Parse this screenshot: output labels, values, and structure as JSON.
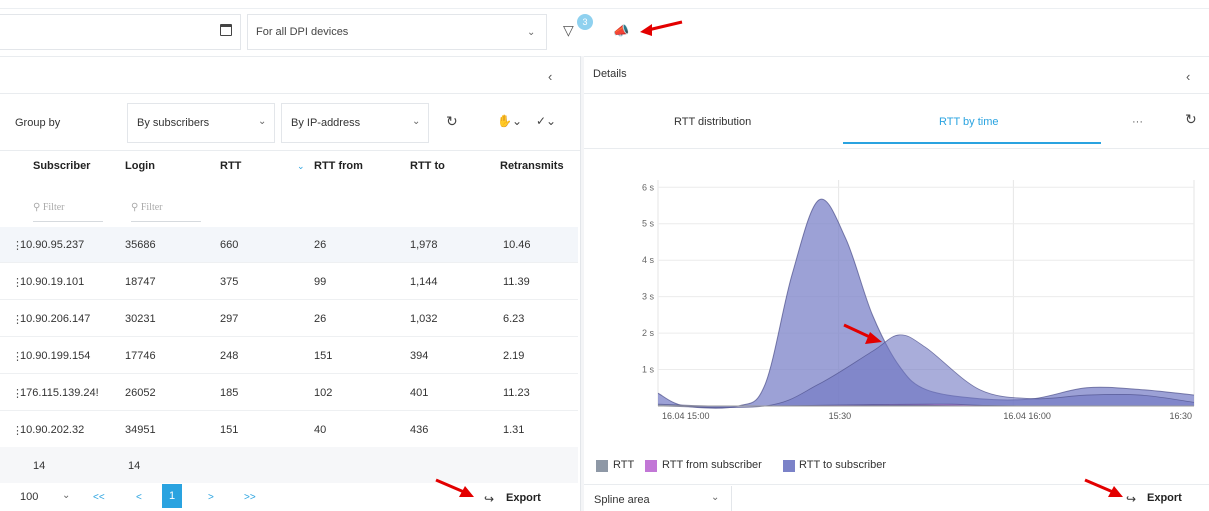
{
  "toolbar": {
    "dpi_select": "For all DPI devices",
    "filter_badge": "3"
  },
  "left": {
    "group_by_label": "Group by",
    "group_select_1": "By subscribers",
    "group_select_2": "By IP-address",
    "columns": [
      "Subscriber",
      "Login",
      "RTT",
      "RTT from",
      "RTT to",
      "Retransmits"
    ],
    "filter_placeholder": "Filter",
    "rows": [
      [
        "10.90.95.237",
        "35686",
        "660",
        "26",
        "1,978",
        "10.46"
      ],
      [
        "10.90.19.101",
        "18747",
        "375",
        "99",
        "1,144",
        "11.39"
      ],
      [
        "10.90.206.147",
        "30231",
        "297",
        "26",
        "1,032",
        "6.23"
      ],
      [
        "10.90.199.154",
        "17746",
        "248",
        "151",
        "394",
        "2.19"
      ],
      [
        "176.115.139.24!",
        "26052",
        "185",
        "102",
        "401",
        "11.23"
      ],
      [
        "10.90.202.32",
        "34951",
        "151",
        "40",
        "436",
        "1.31"
      ]
    ],
    "footer": [
      "14",
      "14"
    ],
    "page_size": "100",
    "pager": {
      "first": "<<",
      "prev": "<",
      "current": "1",
      "next": ">",
      "last": ">>"
    },
    "export": "Export"
  },
  "right": {
    "title": "Details",
    "tabs": [
      "RTT distribution",
      "RTT by time"
    ],
    "more": "···",
    "chart_type": "Spline area",
    "export": "Export"
  },
  "chart_data": {
    "type": "area",
    "x": [
      "16.04 15:00",
      "15:30",
      "16.04 16:00",
      "16:30"
    ],
    "y_ticks": [
      "1 s",
      "2 s",
      "3 s",
      "4 s",
      "5 s",
      "6 s"
    ],
    "ylim": [
      0,
      6.2
    ],
    "series": [
      {
        "name": "RTT",
        "color": "#8e98a6",
        "points": [
          [
            0,
            0.05
          ],
          [
            10,
            0
          ],
          [
            20,
            0
          ],
          [
            30,
            0
          ],
          [
            40,
            0.02
          ],
          [
            50,
            0.02
          ],
          [
            60,
            0
          ],
          [
            70,
            0
          ],
          [
            90,
            0
          ],
          [
            100,
            0
          ]
        ]
      },
      {
        "name": "RTT from subscriber",
        "color": "#c277d6",
        "points": [
          [
            0,
            0
          ],
          [
            20,
            0
          ],
          [
            30,
            0.02
          ],
          [
            40,
            0.04
          ],
          [
            50,
            0.05
          ],
          [
            55,
            0.05
          ],
          [
            60,
            0.02
          ],
          [
            70,
            0
          ],
          [
            100,
            0
          ]
        ]
      },
      {
        "name": "RTT to subscriber",
        "color": "#7b82c8",
        "points": [
          [
            0,
            0.35
          ],
          [
            5,
            0
          ],
          [
            15,
            0
          ],
          [
            20,
            0.6
          ],
          [
            25,
            3.6
          ],
          [
            30,
            5.65
          ],
          [
            35,
            4.6
          ],
          [
            40,
            2.5
          ],
          [
            45,
            1.1
          ],
          [
            50,
            0.45
          ],
          [
            60,
            0.2
          ],
          [
            70,
            0.2
          ],
          [
            80,
            0.5
          ],
          [
            90,
            0.45
          ],
          [
            100,
            0.3
          ]
        ]
      },
      {
        "name": "RTT to subscriber",
        "color": "#6f76c2",
        "points": [
          [
            0,
            0
          ],
          [
            20,
            0
          ],
          [
            30,
            0.6
          ],
          [
            40,
            1.5
          ],
          [
            45,
            1.95
          ],
          [
            50,
            1.6
          ],
          [
            60,
            0.45
          ],
          [
            70,
            0.2
          ],
          [
            80,
            0.3
          ],
          [
            90,
            0.3
          ],
          [
            100,
            0.1
          ]
        ]
      }
    ],
    "legend": [
      "RTT",
      "RTT from subscriber",
      "RTT to subscriber"
    ],
    "legend_colors": [
      "#8e98a6",
      "#c277d6",
      "#7b82c8"
    ],
    "grid": true,
    "legend_placement": "bottom"
  }
}
